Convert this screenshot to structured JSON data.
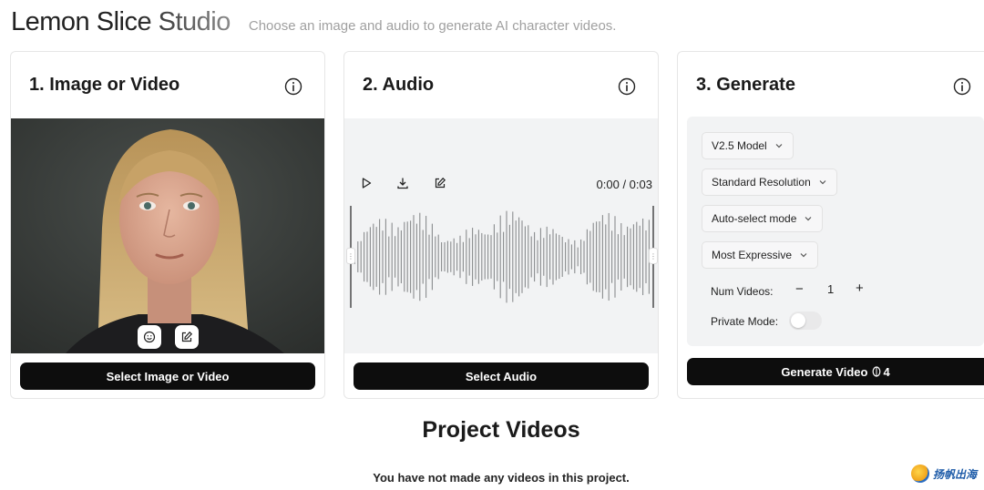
{
  "header": {
    "title": "Lemon Slice Studio",
    "subtitle": "Choose an image and audio to generate AI character videos."
  },
  "image_card": {
    "title": "1. Image or Video",
    "select_label": "Select Image or Video"
  },
  "audio_card": {
    "title": "2. Audio",
    "time": "0:00 / 0:03",
    "select_label": "Select Audio"
  },
  "generate_card": {
    "title": "3. Generate",
    "model": "V2.5 Model",
    "resolution": "Standard Resolution",
    "mode": "Auto-select mode",
    "expressiveness": "Most Expressive",
    "num_videos_label": "Num Videos:",
    "minus": "−",
    "num_videos_value": "1",
    "plus": "+",
    "private_label": "Private Mode:",
    "private_enabled": false,
    "generate_label": "Generate Video",
    "credits": "4"
  },
  "projects": {
    "title": "Project Videos",
    "empty_message": "You have not made any videos in this project."
  },
  "watermark": {
    "text": "扬帆出海"
  }
}
